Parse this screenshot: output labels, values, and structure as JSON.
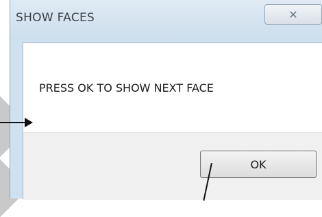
{
  "dialog": {
    "title": "SHOW FACES",
    "close_icon": "close-x-icon",
    "message": "PRESS OK TO SHOW NEXT FACE",
    "ok_label": "OK"
  }
}
